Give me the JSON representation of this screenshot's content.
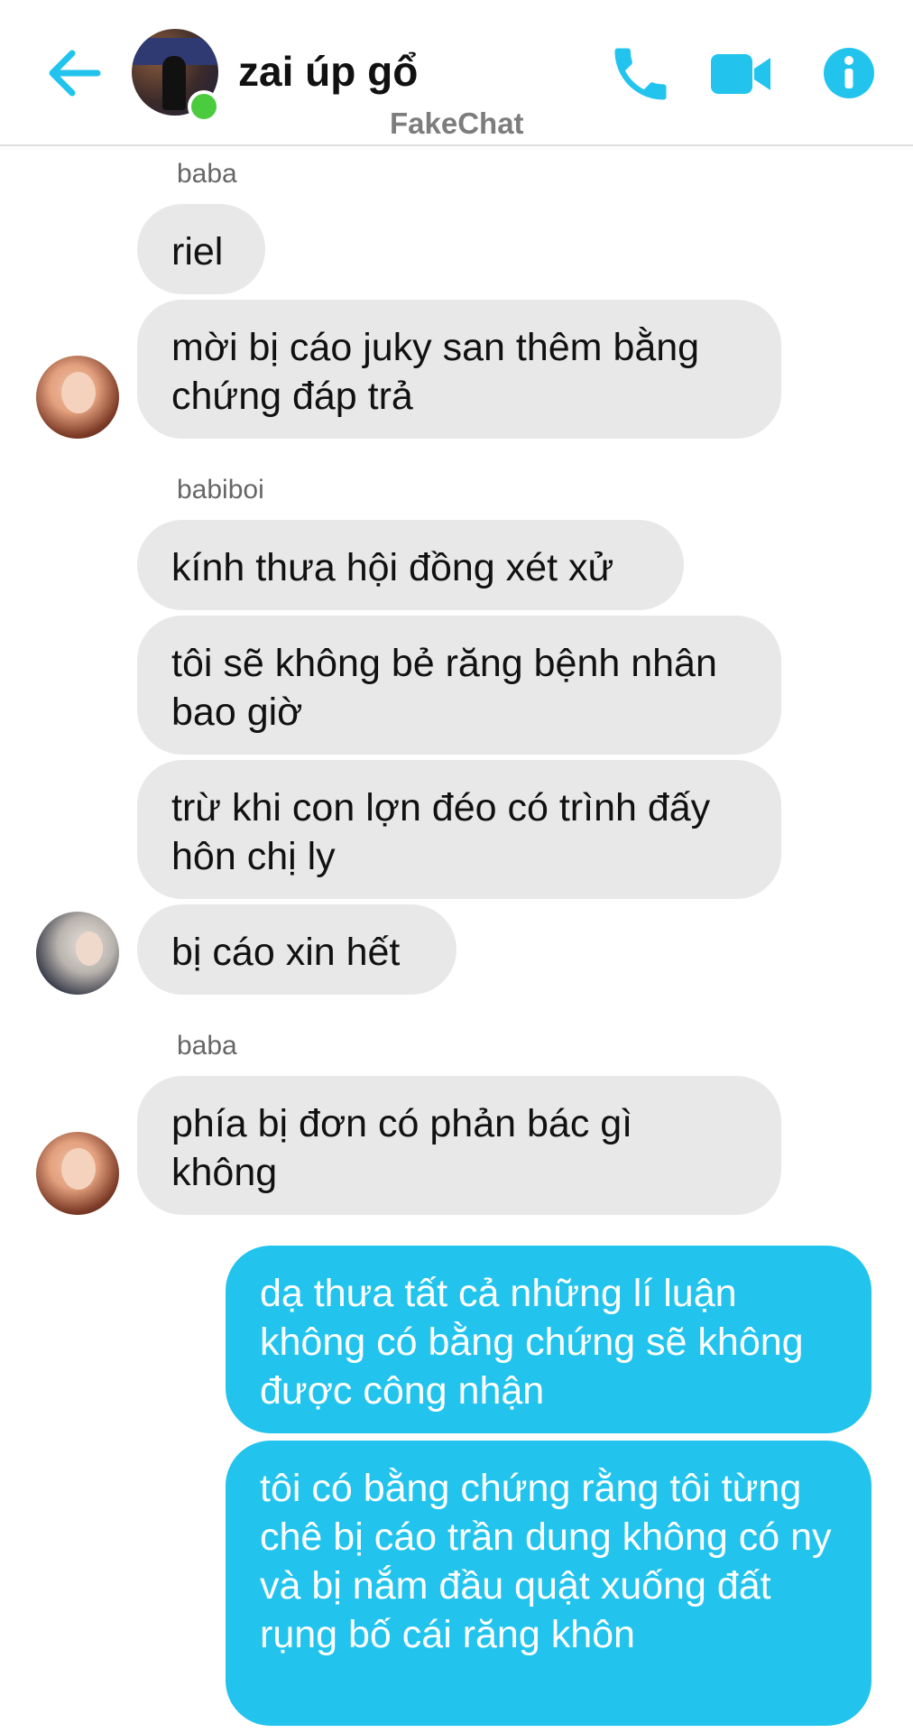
{
  "header": {
    "contact_name": "zai úp gổ",
    "watermark": "FakeChat",
    "accent_color": "#22c4ee",
    "online_color": "#4bcb3e",
    "icons": [
      "arrow-left-icon",
      "phone-icon",
      "video-camera-icon",
      "info-icon"
    ]
  },
  "messages": [
    {
      "sender": "baba",
      "text": "riel"
    },
    {
      "text": "mời bị cáo juky san thêm bằng chứng đáp trả"
    },
    {
      "sender": "babiboi",
      "text": "kính thưa hội đồng xét xử"
    },
    {
      "text": "tôi sẽ không bẻ răng bệnh nhân bao giờ"
    },
    {
      "text": "trừ khi con lợn đéo có trình đấy hôn chị ly"
    },
    {
      "text": "bị cáo xin hết"
    },
    {
      "sender": "baba",
      "text": "phía bị đơn có phản bác gì không"
    },
    {
      "text": "dạ thưa tất cả những lí luận không có bằng chứng sẽ không được công nhận"
    },
    {
      "text": "tôi có bằng chứng rằng tôi từng chê bị cáo trần dung không có ny và bị nắm đầu quật xuống đất rụng bố cái răng khôn"
    }
  ]
}
